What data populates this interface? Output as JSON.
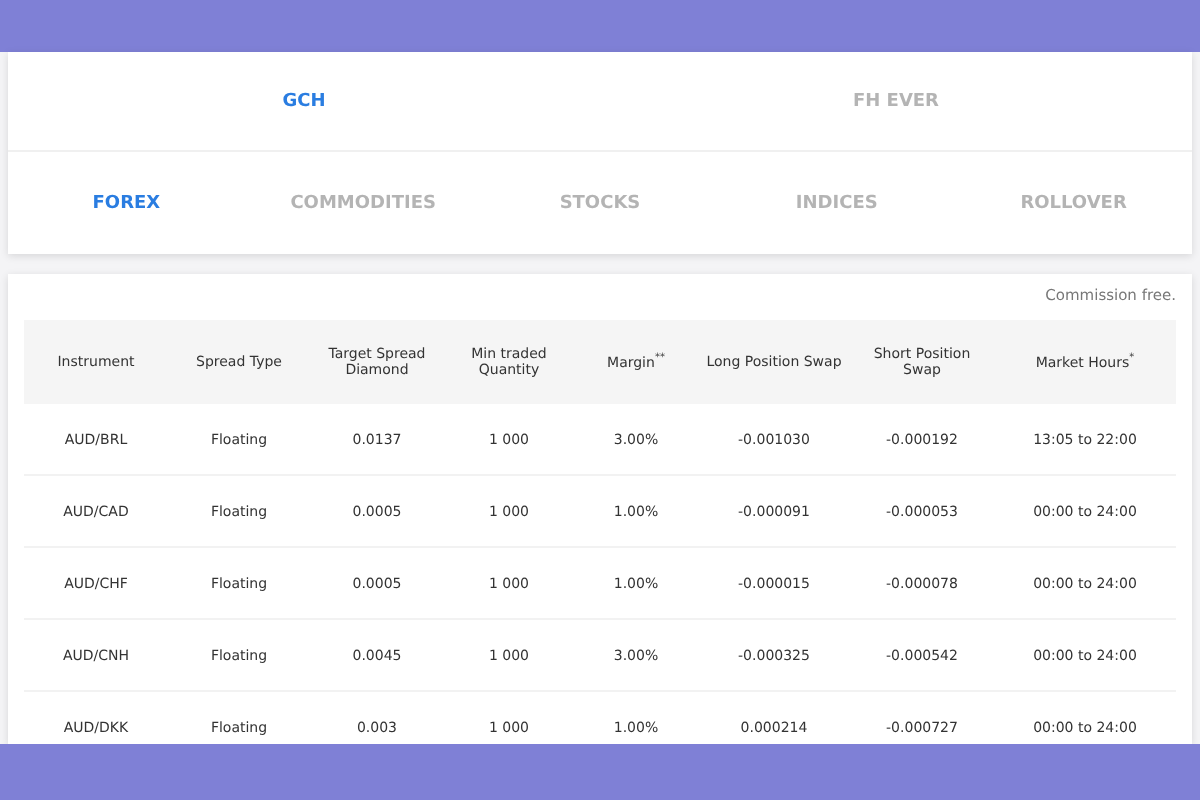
{
  "brand_tabs": [
    {
      "label": "GCH",
      "selected": true
    },
    {
      "label": "FH EVER",
      "selected": false
    }
  ],
  "category_tabs": [
    {
      "label": "FOREX",
      "selected": true
    },
    {
      "label": "COMMODITIES",
      "selected": false
    },
    {
      "label": "STOCKS",
      "selected": false
    },
    {
      "label": "INDICES",
      "selected": false
    },
    {
      "label": "ROLLOVER",
      "selected": false
    }
  ],
  "note": "Commission free.",
  "table": {
    "columns": [
      "Instrument",
      "Spread Type",
      "Target Spread Diamond",
      "Min traded Quantity",
      "Margin$^{**}$",
      "Long Position Swap",
      "Short Position Swap",
      "Market Hours$^{*}$"
    ],
    "rows": [
      [
        "AUD/BRL",
        "Floating",
        "0.0137",
        "1 000",
        "3.00%",
        "-0.001030",
        "-0.000192",
        "13:05 to 22:00"
      ],
      [
        "AUD/CAD",
        "Floating",
        "0.0005",
        "1 000",
        "1.00%",
        "-0.000091",
        "-0.000053",
        "00:00 to 24:00"
      ],
      [
        "AUD/CHF",
        "Floating",
        "0.0005",
        "1 000",
        "1.00%",
        "-0.000015",
        "-0.000078",
        "00:00 to 24:00"
      ],
      [
        "AUD/CNH",
        "Floating",
        "0.0045",
        "1 000",
        "3.00%",
        "-0.000325",
        "-0.000542",
        "00:00 to 24:00"
      ],
      [
        "AUD/DKK",
        "Floating",
        "0.003",
        "1 000",
        "1.00%",
        "0.000214",
        "-0.000727",
        "00:00 to 24:00"
      ]
    ]
  }
}
